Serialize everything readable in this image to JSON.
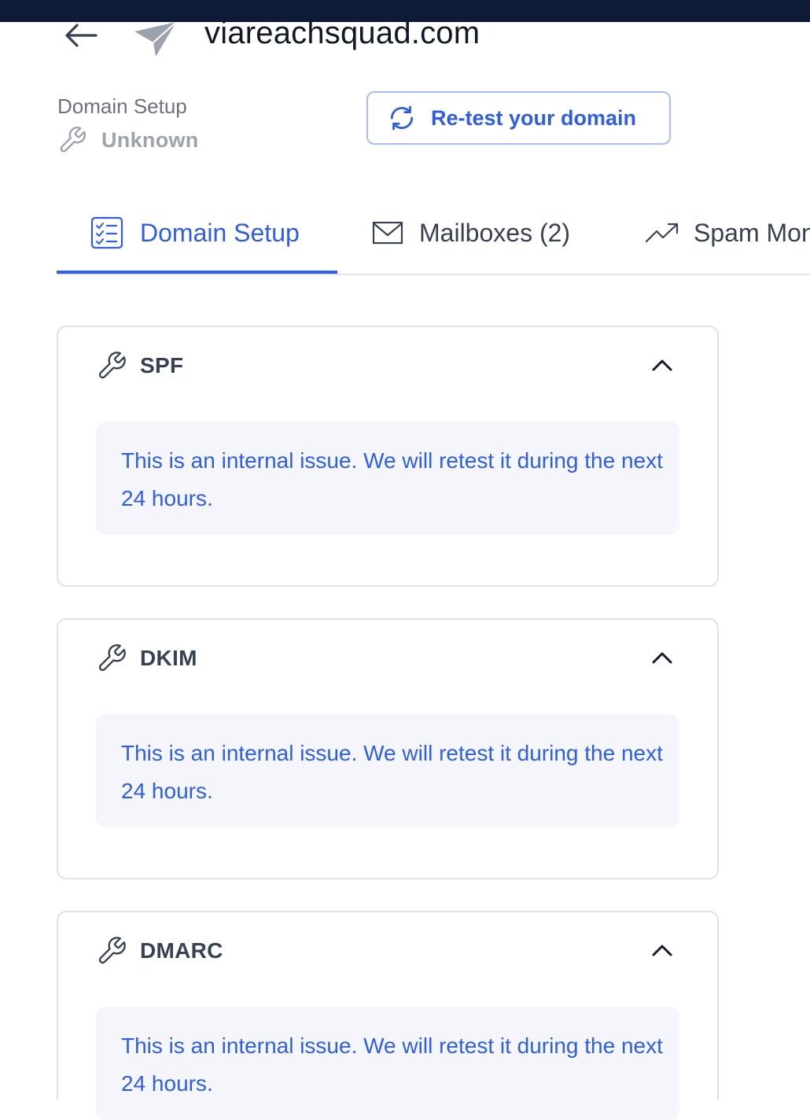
{
  "header": {
    "domain": "viareachsquad.com",
    "back_icon": "arrow-left-icon",
    "brand_icon": "paper-plane-icon"
  },
  "status": {
    "label": "Domain Setup",
    "value": "Unknown",
    "icon": "wrench-icon"
  },
  "actions": {
    "retest_label": "Re-test your domain",
    "retest_icon": "refresh-icon"
  },
  "tabs": [
    {
      "label": "Domain Setup",
      "icon": "checklist-icon",
      "active": true
    },
    {
      "label": "Mailboxes (2)",
      "icon": "envelope-icon",
      "active": false
    },
    {
      "label": "Spam Mon",
      "icon": "trend-up-icon",
      "active": false
    }
  ],
  "checks": [
    {
      "title": "SPF",
      "message": "This is an internal issue. We will retest it during the next 24 hours.",
      "expanded": true
    },
    {
      "title": "DKIM",
      "message": "This is an internal issue. We will retest it during the next 24 hours.",
      "expanded": true
    },
    {
      "title": "DMARC",
      "message": "This is an internal issue. We will retest it during the next 24 hours.",
      "expanded": true
    }
  ],
  "colors": {
    "accent": "#2f5fe0",
    "topbar": "#0d1a36",
    "message_bg": "#f5f6fb",
    "card_border": "#dfe2e7",
    "muted_text": "#9ca3af"
  }
}
